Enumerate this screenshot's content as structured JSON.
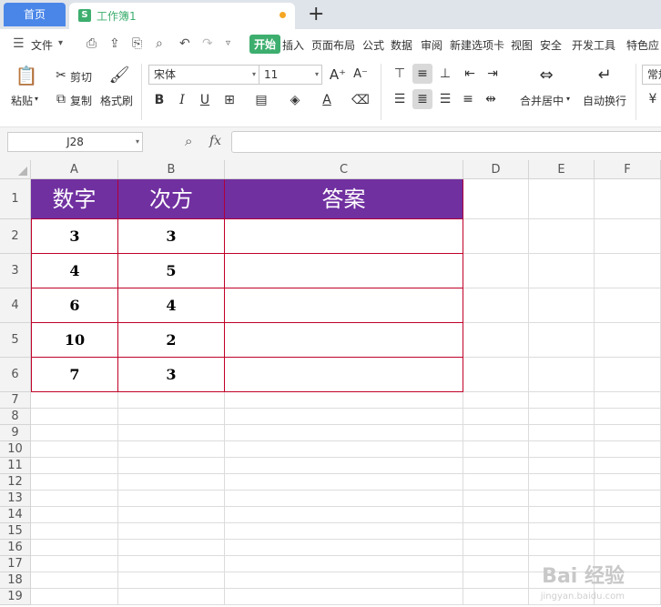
{
  "tabs": {
    "home": "首页",
    "document": "工作簿1",
    "new_tab": "+"
  },
  "menu": {
    "file": "文件",
    "items": [
      "开始",
      "插入",
      "页面布局",
      "公式",
      "数据",
      "审阅",
      "新建选项卡",
      "视图",
      "安全",
      "开发工具",
      "特色应"
    ]
  },
  "ribbon": {
    "paste": "粘贴",
    "cut": "剪切",
    "copy": "复制",
    "format_painter": "格式刷",
    "font_name": "宋体",
    "font_size": "11",
    "merge_center": "合并居中",
    "auto_wrap": "自动换行",
    "number_format": "常规"
  },
  "formula_bar": {
    "cell_ref": "J28",
    "fx_label": "fx",
    "formula": ""
  },
  "columns": [
    "A",
    "B",
    "C",
    "D",
    "E",
    "F"
  ],
  "rows": [
    "1",
    "2",
    "3",
    "4",
    "5",
    "6",
    "7",
    "8",
    "9",
    "10",
    "11",
    "12",
    "13",
    "14",
    "15",
    "16",
    "17",
    "18",
    "19"
  ],
  "table": {
    "headers": [
      "数字",
      "次方",
      "答案"
    ],
    "rows": [
      [
        "3",
        "3",
        ""
      ],
      [
        "4",
        "5",
        ""
      ],
      [
        "6",
        "4",
        ""
      ],
      [
        "10",
        "2",
        ""
      ],
      [
        "7",
        "3",
        ""
      ]
    ]
  },
  "colors": {
    "header_fill": "#7030a0",
    "border_red": "#c00028",
    "accent_green": "#3dae6e",
    "home_tab_blue": "#4a86e8"
  },
  "watermark": {
    "brand": "Bai 经验",
    "url": "jingyan.baidu.com"
  }
}
